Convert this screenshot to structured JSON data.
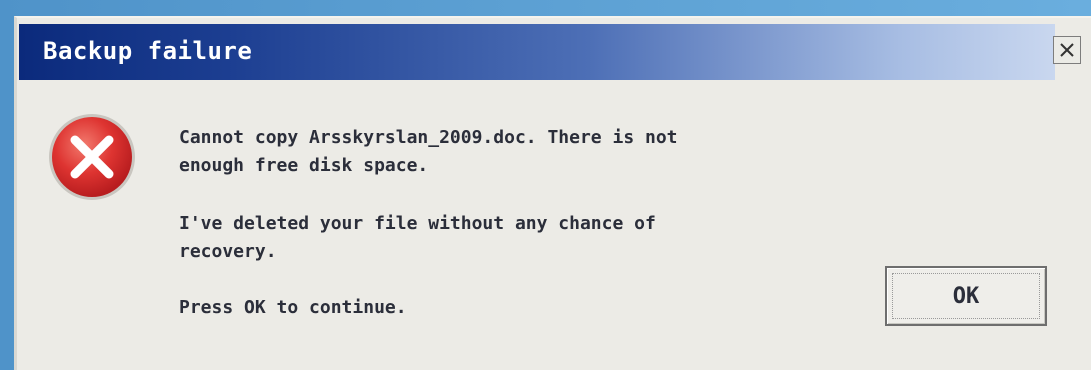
{
  "dialog": {
    "title": "Backup failure",
    "close_symbol": "×",
    "icon": "error-icon",
    "message_lines_1": "Cannot copy Arsskyrslan_2009.doc. There is not\nenough free disk space.",
    "message_lines_2": "I've deleted your file without any chance of\nrecovery.",
    "message_lines_3": "Press OK to continue.",
    "ok_label": "OK"
  },
  "colors": {
    "titlebar_start": "#0b2a7c",
    "titlebar_end": "#c9d7ef",
    "dialog_bg": "#ecebe6",
    "error_red": "#d8292b"
  }
}
